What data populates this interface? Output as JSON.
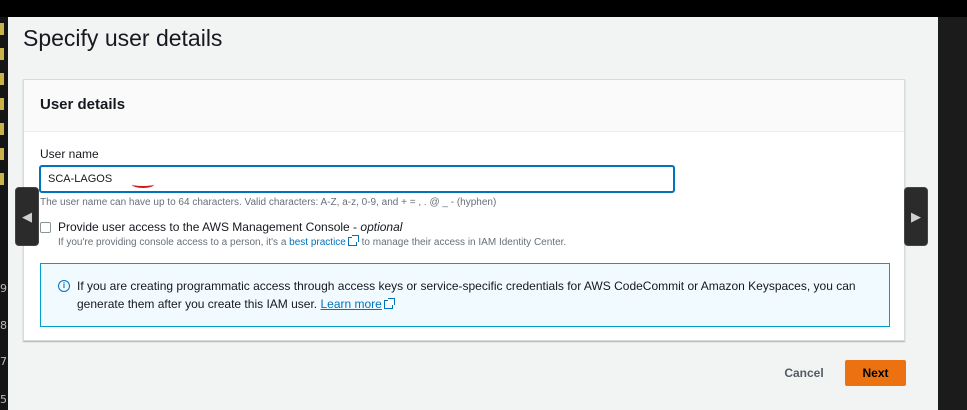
{
  "page": {
    "title": "Specify user details"
  },
  "panel": {
    "title": "User details"
  },
  "user_name": {
    "label": "User name",
    "value": "SCA-LAGOS",
    "hint": "The user name can have up to 64 characters. Valid characters: A-Z, a-z, 0-9, and + = , . @ _ - (hyphen)"
  },
  "console_access": {
    "label": "Provide user access to the AWS Management Console -",
    "optional": "optional",
    "checked": false,
    "desc_before": "If you're providing console access to a person, it's a",
    "link": "best practice",
    "desc_after": "to manage their access in IAM Identity Center."
  },
  "info": {
    "text": "If you are creating programmatic access through access keys or service-specific credentials for AWS CodeCommit or Amazon Keyspaces, you can generate them after you create this IAM user.",
    "link": "Learn more"
  },
  "actions": {
    "cancel": "Cancel",
    "next": "Next"
  },
  "viewer": {
    "prev_icon": "◀",
    "next_icon": "▶"
  },
  "left_strip_numbers": [
    "9",
    "8",
    "7",
    "5"
  ],
  "colors": {
    "primary_button": "#ec7211",
    "link": "#0073bb",
    "info_border": "#00a1c9",
    "info_bg": "#f1faff"
  }
}
